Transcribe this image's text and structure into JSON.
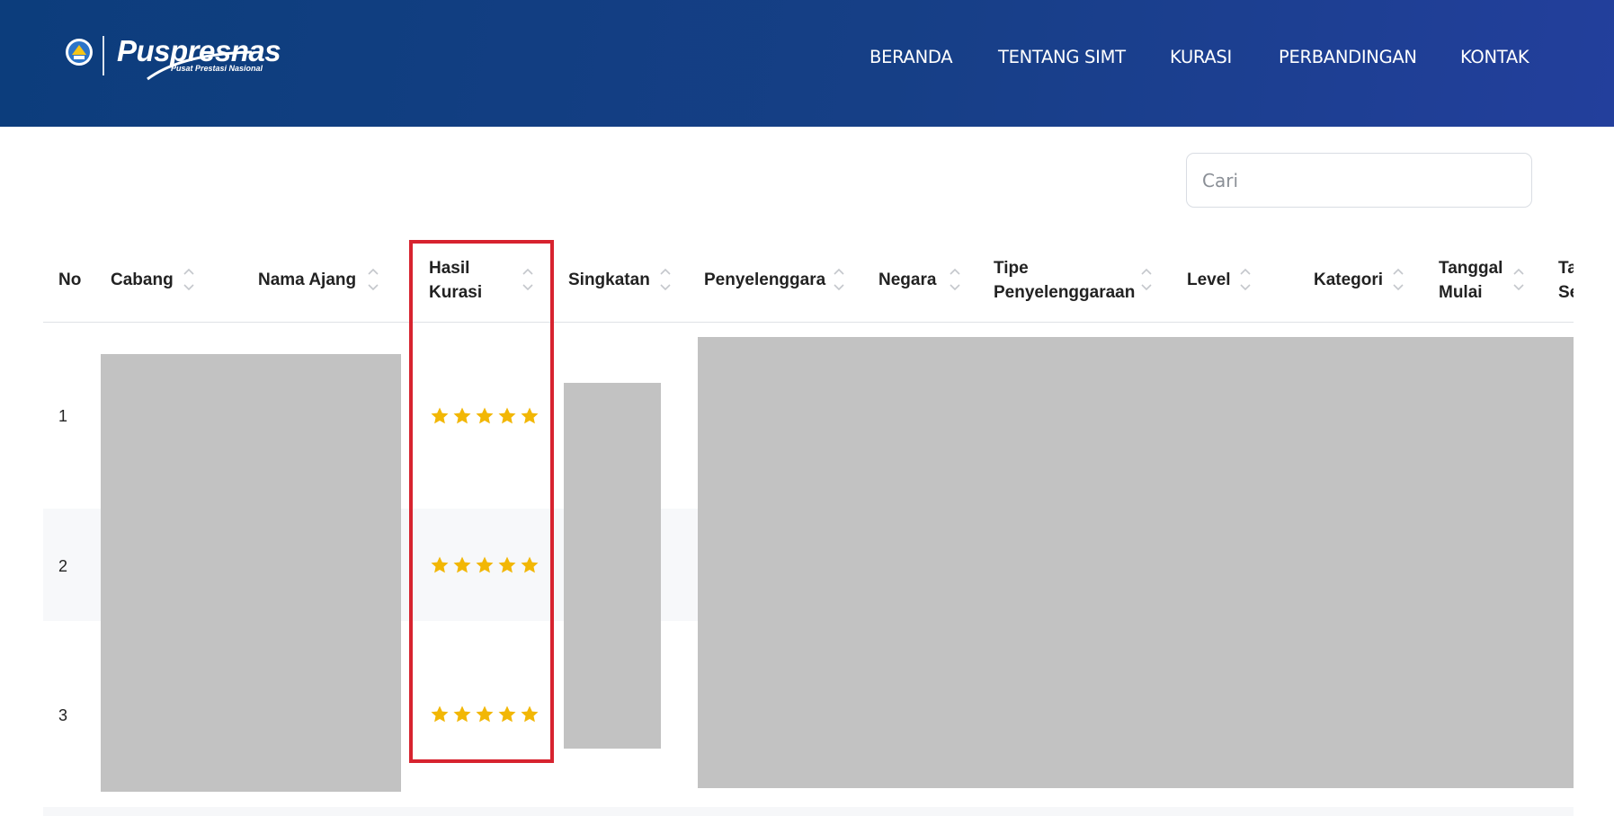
{
  "header": {
    "logo_word": "Puspresnas",
    "logo_sub": "Pusat Prestasi Nasional",
    "emblem": "tut-wuri-handayani-emblem-icon",
    "nav": [
      "BERANDA",
      "TENTANG SIMT",
      "KURASI",
      "PERBANDINGAN",
      "KONTAK"
    ]
  },
  "search": {
    "placeholder": "Cari",
    "value": ""
  },
  "table": {
    "columns": [
      [
        "No"
      ],
      [
        "Cabang"
      ],
      [
        "Nama Ajang"
      ],
      [
        "Hasil",
        "Kurasi"
      ],
      [
        "Singkatan"
      ],
      [
        "Penyelenggara"
      ],
      [
        "Negara"
      ],
      [
        "Tipe",
        "Penyelenggaraan"
      ],
      [
        "Level"
      ],
      [
        "Kategori"
      ],
      [
        "Tanggal",
        "Mulai"
      ],
      [
        "Ta",
        "Se"
      ]
    ],
    "rows": [
      {
        "no": "1",
        "rating": 5
      },
      {
        "no": "2",
        "rating": 5
      },
      {
        "no": "3",
        "rating": 5
      }
    ]
  },
  "colors": {
    "header_from": "#0c3d7c",
    "header_to": "#233f9c",
    "star": "#f2b705",
    "highlight": "#d7232f",
    "redaction": "#c2c2c2"
  }
}
